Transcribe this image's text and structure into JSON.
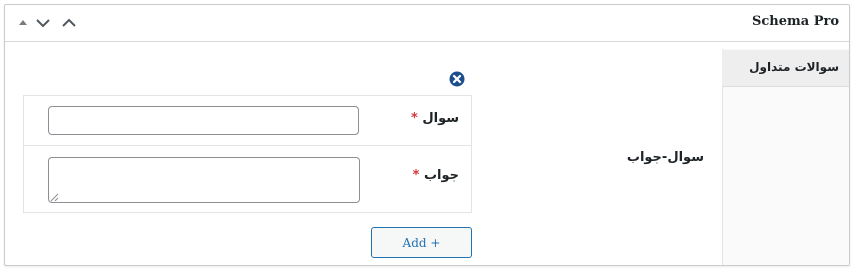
{
  "panel": {
    "title": "Schema Pro",
    "controls": [
      "arrow-up-small-icon",
      "chevron-down-icon",
      "chevron-up-icon"
    ]
  },
  "sidebar": {
    "items": [
      {
        "label": "سوالات متداول",
        "active": true
      }
    ]
  },
  "field": {
    "label": "سوال-جواب"
  },
  "repeater": {
    "remove_icon": "close-circle-icon",
    "rows": [
      {
        "label": "سوال",
        "required_mark": "*",
        "value": "",
        "placeholder": ""
      },
      {
        "label": "جواب",
        "required_mark": "*",
        "value": "",
        "placeholder": ""
      }
    ],
    "add_label": "Add +"
  },
  "colors": {
    "accent": "#2271b1",
    "remove_icon": "#1d4f8f",
    "required": "#d63638",
    "border": "#8c8f94",
    "sidebar_active_bg": "#eeeeee"
  }
}
